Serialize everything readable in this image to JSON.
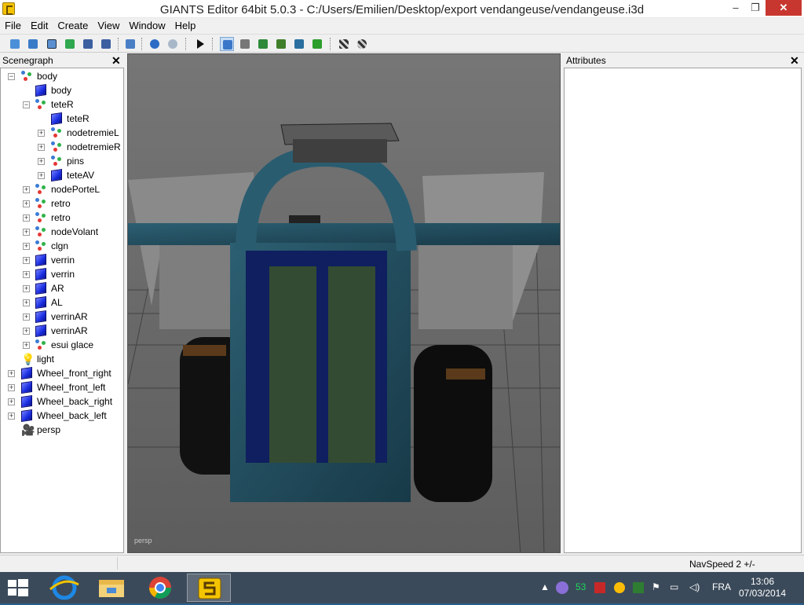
{
  "window": {
    "title": "GIANTS Editor 64bit 5.0.3 - C:/Users/Emilien/Desktop/export vendangeuse/vendangeuse.i3d",
    "minimize": "–",
    "maximize": "❐",
    "close": "✕"
  },
  "menu": [
    "File",
    "Edit",
    "Create",
    "View",
    "Window",
    "Help"
  ],
  "scenegraph": {
    "title": "Scenegraph",
    "close": "✕",
    "nodes": [
      {
        "label": "body",
        "icon": "transform-group-icon",
        "level": 1,
        "expander": "-"
      },
      {
        "label": "body",
        "icon": "shape-cube-icon",
        "level": 2,
        "expander": ""
      },
      {
        "label": "teteR",
        "icon": "transform-group-icon",
        "level": 2,
        "expander": "-"
      },
      {
        "label": "teteR",
        "icon": "shape-cube-icon",
        "level": 3,
        "expander": ""
      },
      {
        "label": "nodetremieL",
        "icon": "transform-group-icon",
        "level": 3,
        "expander": "+"
      },
      {
        "label": "nodetremieR",
        "icon": "transform-group-icon",
        "level": 3,
        "expander": "+"
      },
      {
        "label": "pins",
        "icon": "transform-group-icon",
        "level": 3,
        "expander": "+"
      },
      {
        "label": "teteAV",
        "icon": "shape-cube-icon",
        "level": 3,
        "expander": "+"
      },
      {
        "label": "nodePorteL",
        "icon": "transform-group-icon",
        "level": 2,
        "expander": "+"
      },
      {
        "label": "retro",
        "icon": "transform-group-icon",
        "level": 2,
        "expander": "+"
      },
      {
        "label": "retro",
        "icon": "transform-group-icon",
        "level": 2,
        "expander": "+"
      },
      {
        "label": "nodeVolant",
        "icon": "transform-group-icon",
        "level": 2,
        "expander": "+"
      },
      {
        "label": "clgn",
        "icon": "transform-group-icon",
        "level": 2,
        "expander": "+"
      },
      {
        "label": "verrin",
        "icon": "shape-cube-icon",
        "level": 2,
        "expander": "+"
      },
      {
        "label": "verrin",
        "icon": "shape-cube-icon",
        "level": 2,
        "expander": "+"
      },
      {
        "label": "AR",
        "icon": "shape-cube-icon",
        "level": 2,
        "expander": "+"
      },
      {
        "label": "AL",
        "icon": "shape-cube-icon",
        "level": 2,
        "expander": "+"
      },
      {
        "label": "verrinAR",
        "icon": "shape-cube-icon",
        "level": 2,
        "expander": "+"
      },
      {
        "label": "verrinAR",
        "icon": "shape-cube-icon",
        "level": 2,
        "expander": "+"
      },
      {
        "label": "esui glace",
        "icon": "transform-group-icon",
        "level": 2,
        "expander": "+"
      },
      {
        "label": "light",
        "icon": "light-bulb-icon",
        "level": 1,
        "expander": ""
      },
      {
        "label": "Wheel_front_right",
        "icon": "shape-cube-icon",
        "level": 1,
        "expander": "+"
      },
      {
        "label": "Wheel_front_left",
        "icon": "shape-cube-icon",
        "level": 1,
        "expander": "+"
      },
      {
        "label": "Wheel_back_right",
        "icon": "shape-cube-icon",
        "level": 1,
        "expander": "+"
      },
      {
        "label": "Wheel_back_left",
        "icon": "shape-cube-icon",
        "level": 1,
        "expander": "+"
      },
      {
        "label": "persp",
        "icon": "camera-icon",
        "level": 1,
        "expander": ""
      }
    ]
  },
  "viewport": {
    "camera_label": "persp"
  },
  "attributes": {
    "title": "Attributes",
    "close": "✕"
  },
  "status": {
    "navspeed": "NavSpeed 2 +/-"
  },
  "taskbar": {
    "apps": [
      "internet-explorer-icon",
      "file-explorer-icon",
      "chrome-icon",
      "giants-editor-icon"
    ],
    "tray_count": "53",
    "language": "FRA",
    "time": "13:06",
    "date": "07/03/2014"
  }
}
